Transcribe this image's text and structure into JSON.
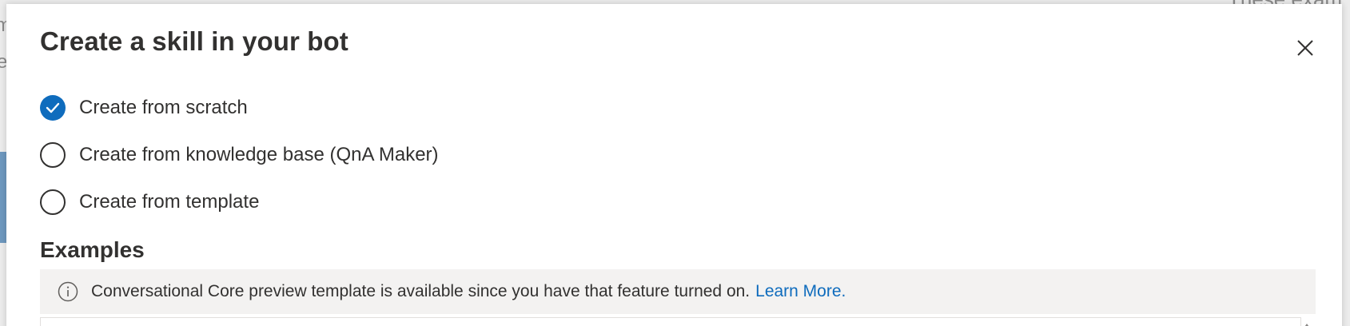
{
  "background": {
    "left_fragment_1": "m",
    "left_fragment_2": "e",
    "right_fragment": "These exam"
  },
  "dialog": {
    "title": "Create a skill in your bot",
    "close_icon": "close-icon",
    "options": [
      {
        "label": "Create from scratch",
        "checked": true
      },
      {
        "label": "Create from knowledge base (QnA Maker)",
        "checked": false
      },
      {
        "label": "Create from template",
        "checked": false
      }
    ],
    "examples_heading": "Examples",
    "info": {
      "icon": "info-icon",
      "text": "Conversational Core preview template is available since you have that feature turned on.",
      "link_label": "Learn More."
    }
  },
  "colors": {
    "accent": "#0f6cbd",
    "text": "#323130",
    "info_bg": "#f3f2f1"
  }
}
